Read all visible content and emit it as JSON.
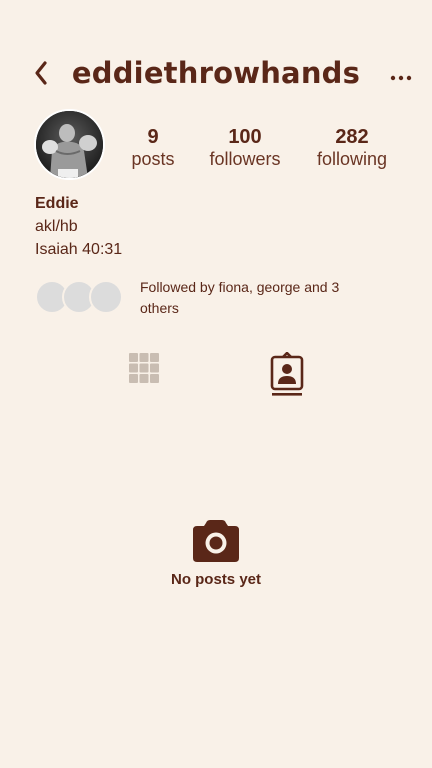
{
  "header": {
    "username": "eddiethrowhands",
    "back_icon": "chevron-left-icon",
    "more_icon": "more-horizontal-icon"
  },
  "profile": {
    "stats": {
      "posts_count": "9",
      "posts_label": "posts",
      "followers_count": "100",
      "followers_label": "followers",
      "following_count": "282",
      "following_label": "following"
    },
    "bio": {
      "name": "Eddie",
      "line1": "akl/hb",
      "line2": "Isaiah 40:31"
    },
    "followed_by": "Followed by fiona, george and 3 others"
  },
  "tabs": [
    {
      "icon": "grid-icon",
      "active": false
    },
    {
      "icon": "tagged-person-icon",
      "active": true
    }
  ],
  "empty_state": {
    "icon": "camera-icon",
    "text": "No posts yet"
  },
  "colors": {
    "background": "#f9f1e8",
    "primary": "#5a2718",
    "inactive_icon": "#c9bdb2",
    "placeholder_avatar": "#dcdcdc"
  }
}
